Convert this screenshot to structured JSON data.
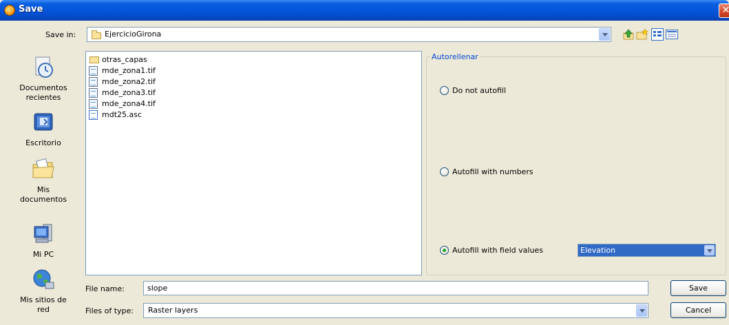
{
  "window": {
    "title": "Save"
  },
  "toolbar": {
    "save_in_label": "Save in:",
    "current_folder": "EjercicioGirona"
  },
  "places": [
    {
      "label": "Documentos recientes",
      "icon": "recent-documents-icon"
    },
    {
      "label": "Escritorio",
      "icon": "desktop-icon"
    },
    {
      "label": "Mis documentos",
      "icon": "my-documents-icon"
    },
    {
      "label": "Mi PC",
      "icon": "my-computer-icon"
    },
    {
      "label": "Mis sitios de red",
      "icon": "network-places-icon"
    }
  ],
  "files": [
    {
      "name": "otras_capas",
      "type": "folder"
    },
    {
      "name": "mde_zona1.tif",
      "type": "tif"
    },
    {
      "name": "mde_zona2.tif",
      "type": "tif"
    },
    {
      "name": "mde_zona3.tif",
      "type": "tif"
    },
    {
      "name": "mde_zona4.tif",
      "type": "tif"
    },
    {
      "name": "mdt25.asc",
      "type": "asc"
    }
  ],
  "autofill": {
    "group_title": "Autorellenar",
    "options": [
      {
        "label": "Do not autofill",
        "selected": false
      },
      {
        "label": "Autofill with numbers",
        "selected": false
      },
      {
        "label": "Autofill with field values",
        "selected": true
      }
    ],
    "field_value": "Elevation"
  },
  "form": {
    "file_name_label": "File name:",
    "file_name_value": "slope",
    "file_type_label": "Files of type:",
    "file_type_value": "Raster layers"
  },
  "buttons": {
    "save": "Save",
    "cancel": "Cancel"
  },
  "colors": {
    "titlebar": "#0454d8",
    "selection": "#316ac5",
    "group_title": "#0046d5",
    "dialog_bg": "#ece9d8"
  }
}
